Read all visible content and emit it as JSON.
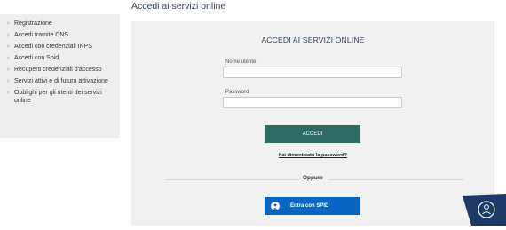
{
  "page": {
    "title": "Accedi ai servizi online"
  },
  "sidebar": {
    "items": [
      {
        "label": "Registrazione"
      },
      {
        "label": "Accedi tramite CNS"
      },
      {
        "label": "Accedi con credenziali INPS"
      },
      {
        "label": "Accedi con Spid"
      },
      {
        "label": "Recupero credenziali d'accesso"
      },
      {
        "label": "Servizi attivi e di futura attivazione"
      },
      {
        "label": "Obblighi per gli utenti dei servizi online"
      }
    ],
    "chevron": "›"
  },
  "login": {
    "heading": "ACCEDI AI SERVIZI ONLINE",
    "username_label": "Nome utente",
    "username_value": "",
    "password_label": "Password",
    "password_value": "",
    "submit_label": "ACCEDI",
    "forgot_label": "hai dimenticato la password?",
    "separator_label": "Oppure",
    "spid_label": "Entra con SPID"
  },
  "icons": {
    "spid": "person-icon",
    "corner": "assistant-icon"
  },
  "colors": {
    "accent_green": "#2d6b63",
    "spid_blue": "#0b66c3",
    "badge_navy": "#1c3a66",
    "title_text": "#2b3f5c",
    "link_chevron": "#4a90c0"
  }
}
